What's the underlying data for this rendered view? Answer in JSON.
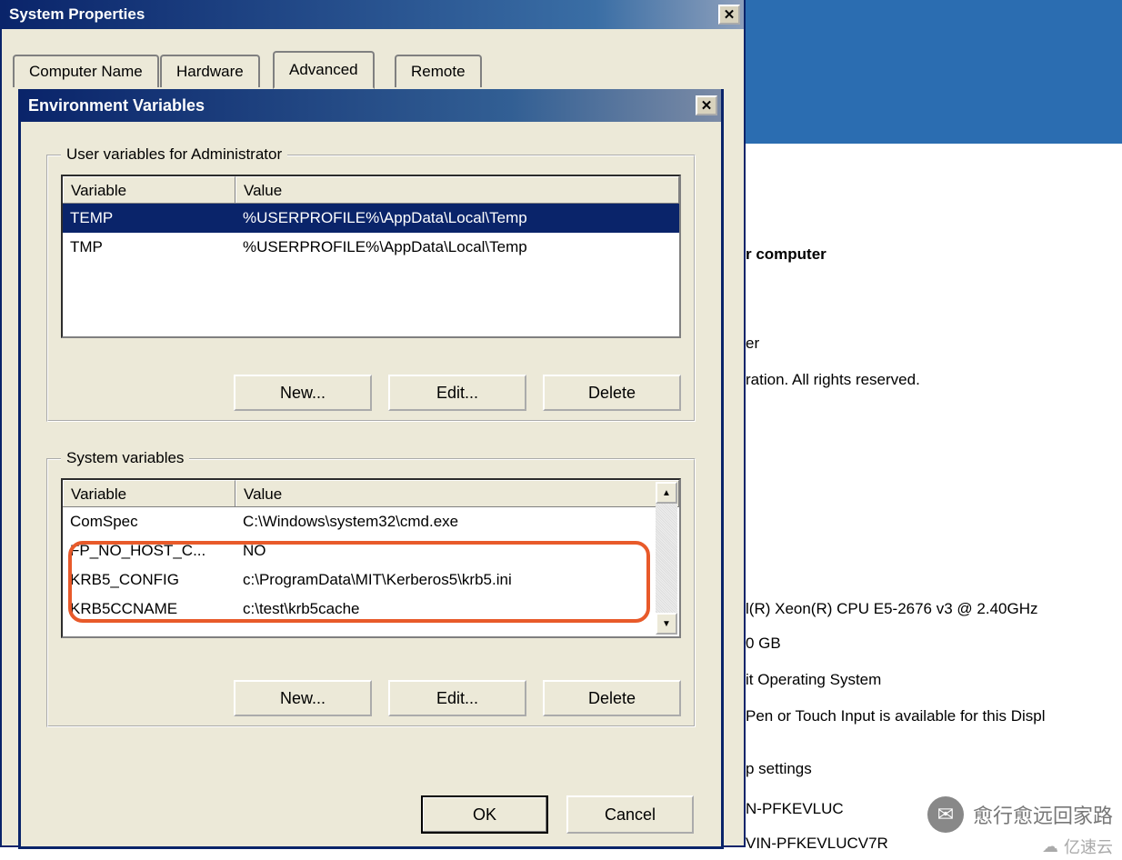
{
  "sysprop": {
    "title": "System Properties",
    "tabs": [
      "Computer Name",
      "Hardware",
      "Advanced",
      "Remote"
    ],
    "active_tab": 2
  },
  "env": {
    "title": "Environment Variables",
    "user_group": "User variables for Administrator",
    "system_group": "System variables",
    "col_var": "Variable",
    "col_val": "Value",
    "user_vars": [
      {
        "name": "TEMP",
        "value": "%USERPROFILE%\\AppData\\Local\\Temp",
        "selected": true
      },
      {
        "name": "TMP",
        "value": "%USERPROFILE%\\AppData\\Local\\Temp",
        "selected": false
      }
    ],
    "system_vars": [
      {
        "name": "ComSpec",
        "value": "C:\\Windows\\system32\\cmd.exe"
      },
      {
        "name": "FP_NO_HOST_C...",
        "value": "NO"
      },
      {
        "name": "KRB5_CONFIG",
        "value": "c:\\ProgramData\\MIT\\Kerberos5\\krb5.ini"
      },
      {
        "name": "KRB5CCNAME",
        "value": "c:\\test\\krb5cache"
      }
    ],
    "btn_new": "New...",
    "btn_edit": "Edit...",
    "btn_delete": "Delete",
    "btn_ok": "OK",
    "btn_cancel": "Cancel"
  },
  "bg": {
    "heading_computer": "r computer",
    "line_er": "er",
    "line_rights": "ration.  All rights reserved.",
    "cpu": "l(R) Xeon(R) CPU E5-2676 v3 @ 2.40GHz",
    "ram": "0 GB",
    "os": "it Operating System",
    "pen": "Pen or Touch Input is available for this Displ",
    "settings": "p settings",
    "name1": "N-PFKEVLUC",
    "name2": "VIN-PFKEVLUCV7R"
  },
  "watermark": {
    "text": "愈行愈远回家路",
    "brand": "亿速云"
  }
}
